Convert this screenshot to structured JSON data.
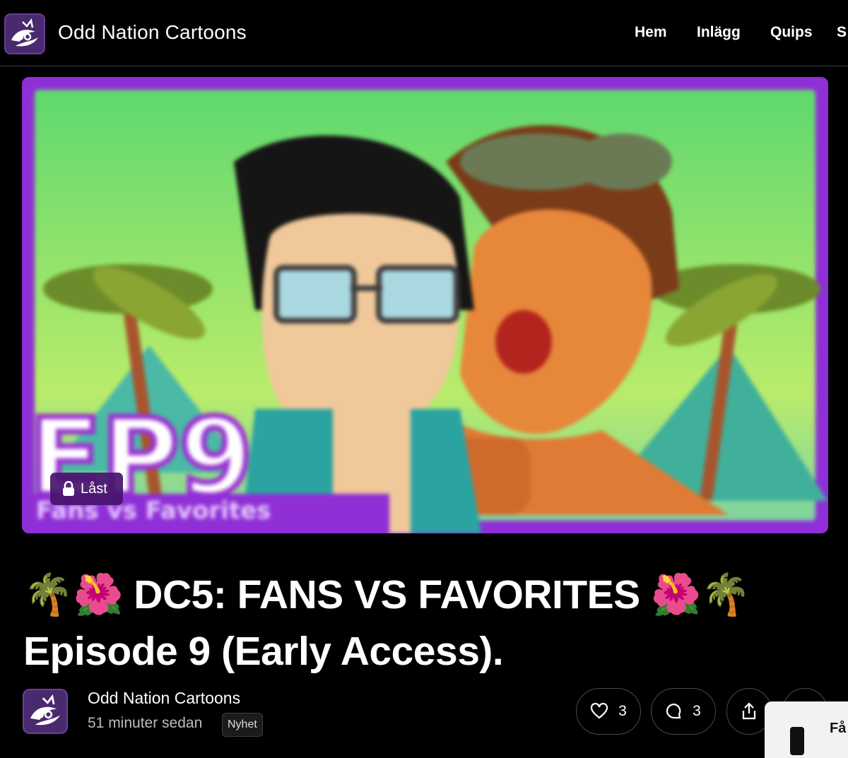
{
  "header": {
    "site_title": "Odd Nation Cartoons",
    "nav": [
      "Hem",
      "Inlägg",
      "Quips",
      "S"
    ]
  },
  "hero": {
    "lock_label": "Låst",
    "overlay_text": "EP9"
  },
  "post": {
    "title_emoji_left": "🌴🌺",
    "title_line1": "DC5: FANS VS FAVORITES",
    "title_emoji_right": "🌺🌴",
    "title_line2": "Episode 9 (Early Access)."
  },
  "author": {
    "name": "Odd Nation Cartoons",
    "time_ago": "51 minuter sedan",
    "tag": "Nyhet"
  },
  "actions": {
    "likes": "3",
    "comments": "3"
  },
  "popup": {
    "label": "Få"
  },
  "colors": {
    "accent": "#8f2fd6",
    "sky": "#6ee07a"
  },
  "icons": [
    "logo-icon",
    "lock-icon",
    "heart-icon",
    "comment-icon",
    "share-icon",
    "more-icon"
  ]
}
